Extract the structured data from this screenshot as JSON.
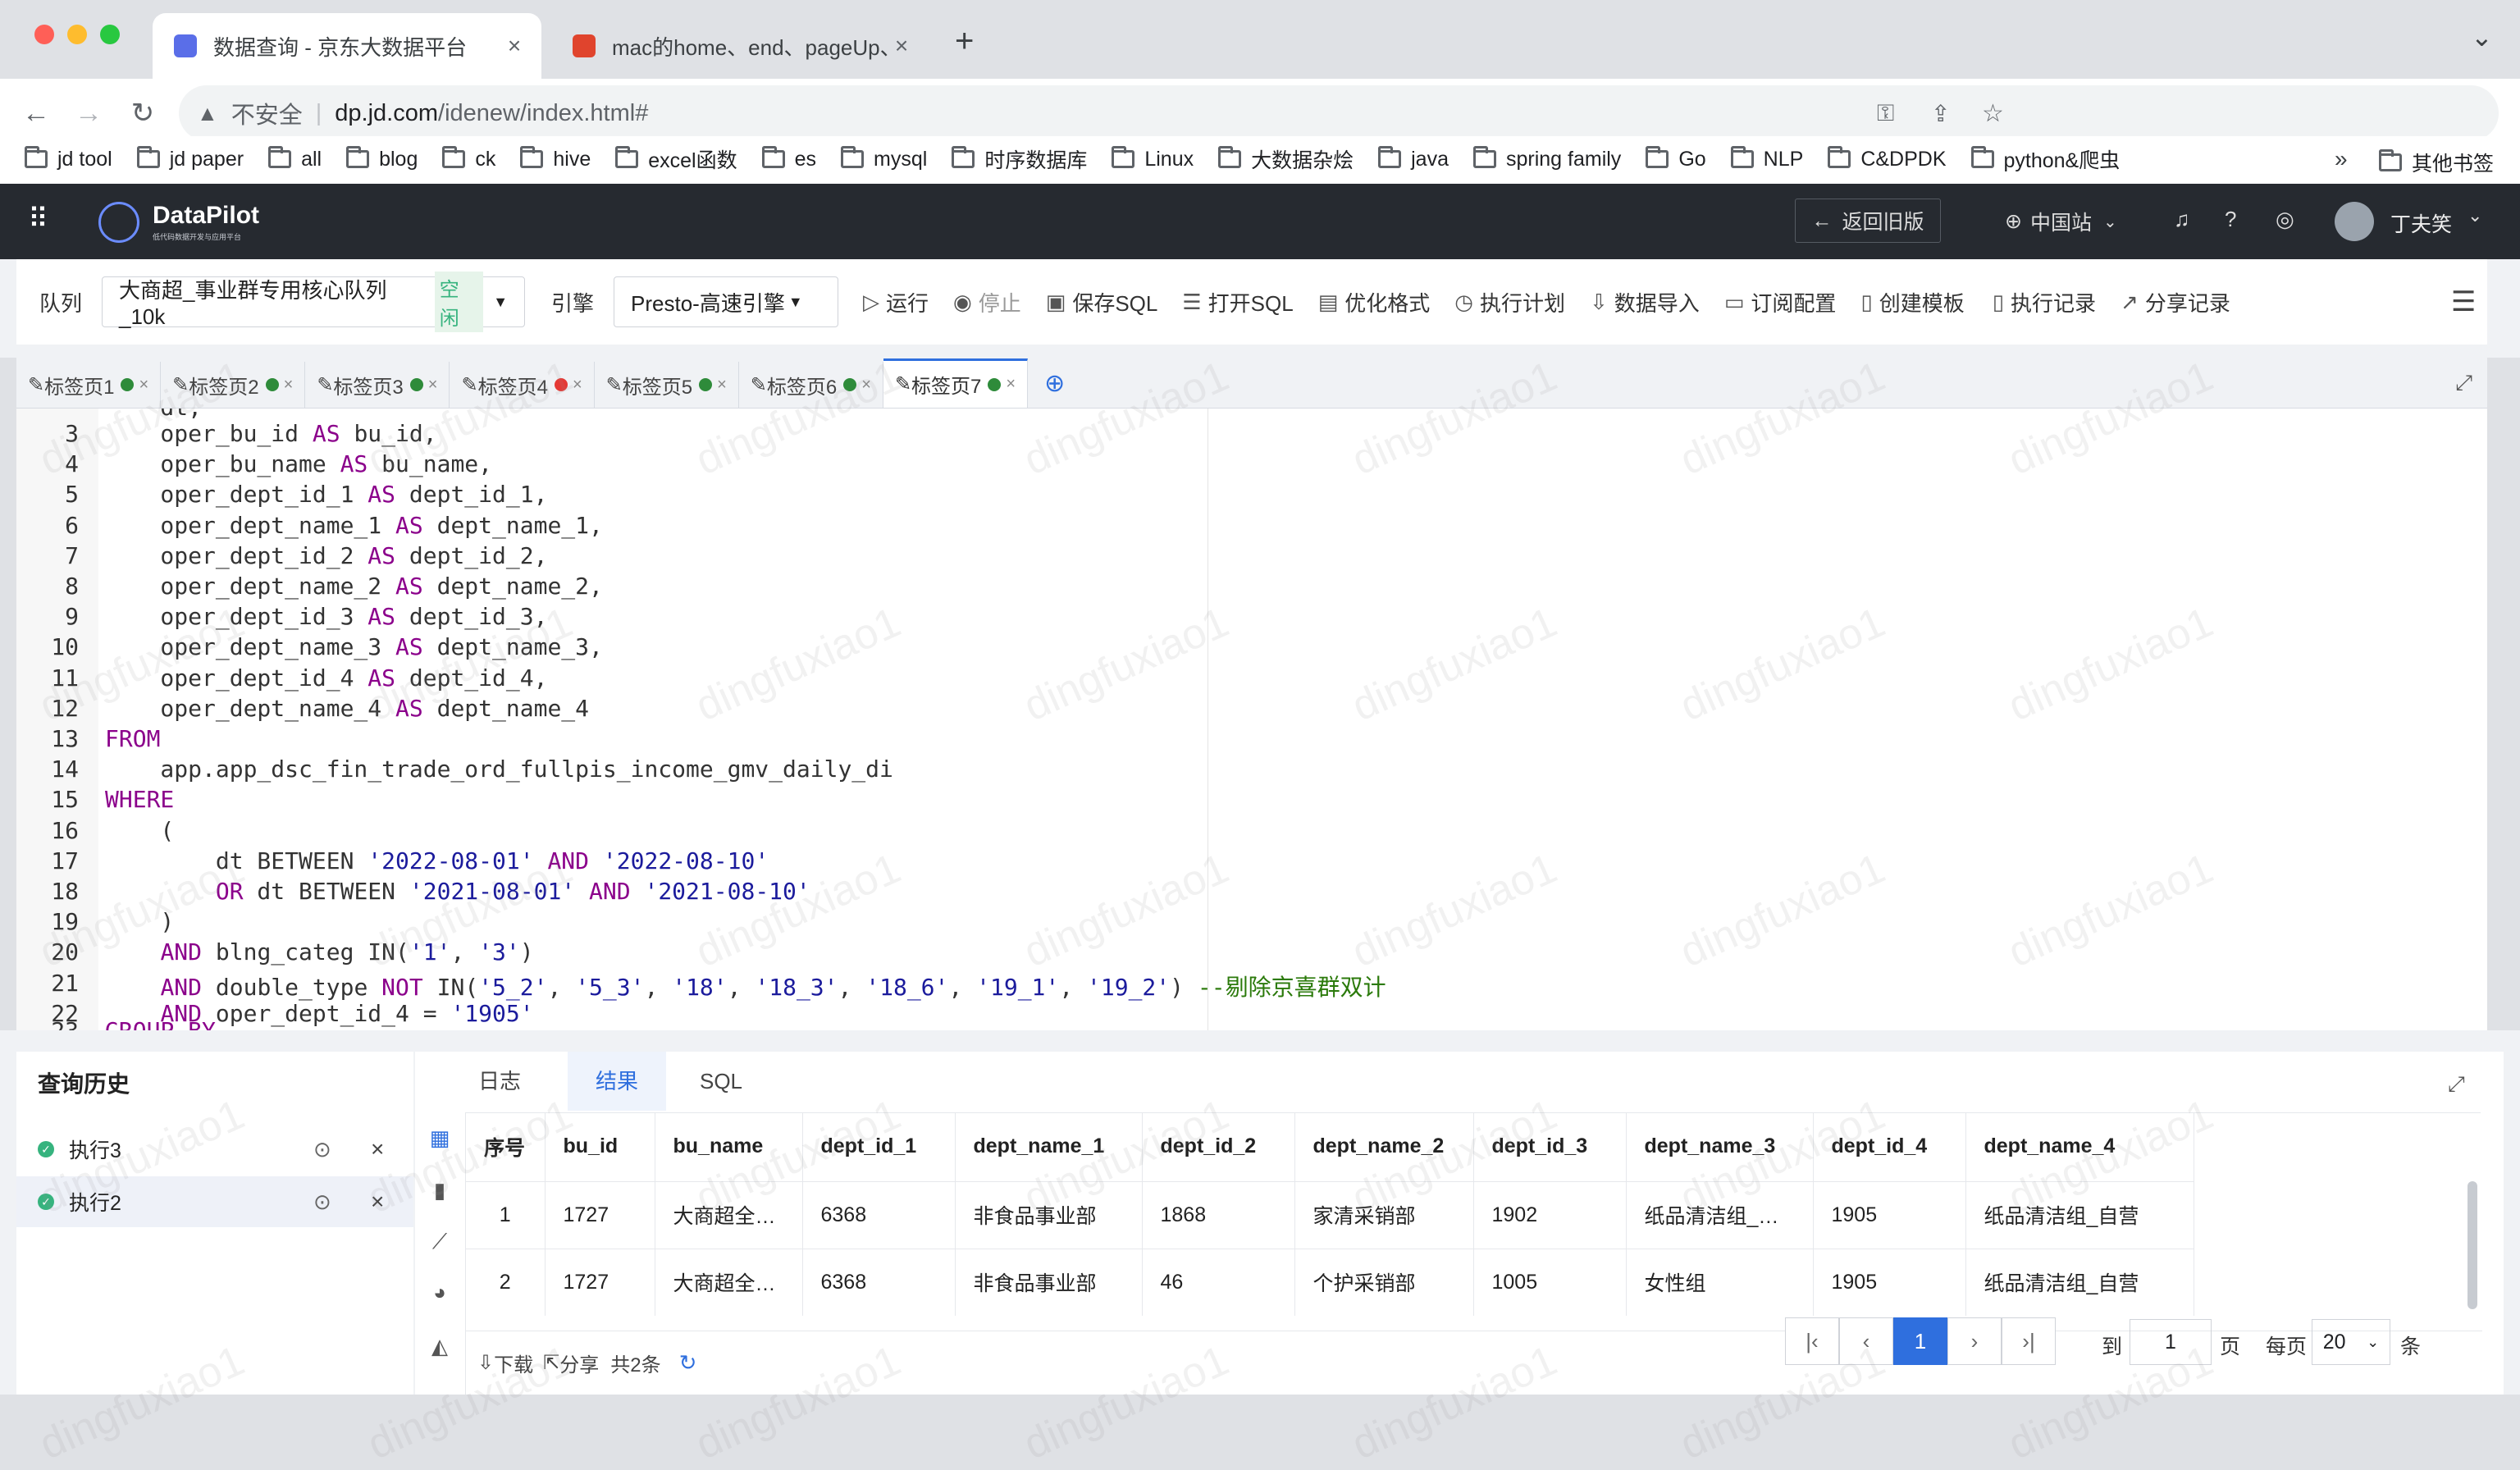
{
  "browser": {
    "tabs": [
      {
        "title": "数据查询 - 京东大数据平台",
        "close": "×",
        "favicon_color": "#5a6ee8"
      },
      {
        "title": "mac的home、end、pageUp、pageDown",
        "close": "×",
        "favicon_color": "#e0442d"
      }
    ],
    "new_tab": "+",
    "tab_menu": "⌄",
    "nav": {
      "back": "←",
      "forward": "→",
      "reload": "↻"
    },
    "security_label": "不安全",
    "url_domain": "dp.jd.com",
    "url_path": "/idenew/index.html#",
    "profile_initials": "夫笑",
    "bookmarks": [
      "jd tool",
      "jd paper",
      "all",
      "blog",
      "ck",
      "hive",
      "excel函数",
      "es",
      "mysql",
      "时序数据库",
      "Linux",
      "大数据杂烩",
      "java",
      "spring family",
      "Go",
      "NLP",
      "C&DPDK",
      "python&爬虫"
    ],
    "bookmarks_overflow": "»",
    "other_bookmarks": "其他书签"
  },
  "app": {
    "logo_title": "DataPilot",
    "logo_subtitle": "低代码数据开发与应用平台",
    "back_old": "返回旧版",
    "region": "中国站",
    "user_name": "丁夫笑"
  },
  "querybar": {
    "queue_label": "队列",
    "queue_value": "大商超_事业群专用核心队列_10k",
    "queue_status": "空闲",
    "engine_label": "引擎",
    "engine_value": "Presto-高速引擎",
    "actions": [
      {
        "icon": "▷",
        "label": "运行",
        "name": "run-button"
      },
      {
        "icon": "◉",
        "label": "停止",
        "name": "stop-button"
      },
      {
        "icon": "▣",
        "label": "保存SQL",
        "name": "save-sql-button"
      },
      {
        "icon": "☰",
        "label": "打开SQL",
        "name": "open-sql-button"
      },
      {
        "icon": "▤",
        "label": "优化格式",
        "name": "format-button"
      },
      {
        "icon": "◷",
        "label": "执行计划",
        "name": "exec-plan-button"
      },
      {
        "icon": "⇩",
        "label": "数据导入",
        "name": "data-import-button"
      },
      {
        "icon": "▭",
        "label": "订阅配置",
        "name": "subscribe-button"
      },
      {
        "icon": "▯",
        "label": "创建模板",
        "name": "create-template-button"
      },
      {
        "icon": "▯",
        "label": "执行记录",
        "name": "exec-record-button"
      },
      {
        "icon": "↗",
        "label": "分享记录",
        "name": "share-record-button"
      }
    ]
  },
  "editor_tabs": [
    {
      "label": "标签页1",
      "status": "#2e8b3a"
    },
    {
      "label": "标签页2",
      "status": "#2e8b3a"
    },
    {
      "label": "标签页3",
      "status": "#2e8b3a"
    },
    {
      "label": "标签页4",
      "status": "#e53935"
    },
    {
      "label": "标签页5",
      "status": "#2e8b3a"
    },
    {
      "label": "标签页6",
      "status": "#2e8b3a"
    },
    {
      "label": "标签页7",
      "status": "#2e8b3a"
    }
  ],
  "code_lines": [
    {
      "n": "3",
      "t": [
        [
          "    oper_bu_id ",
          ""
        ],
        [
          "AS",
          "kw"
        ],
        [
          " bu_id,",
          ""
        ]
      ]
    },
    {
      "n": "4",
      "t": [
        [
          "    oper_bu_name ",
          ""
        ],
        [
          "AS",
          "kw"
        ],
        [
          " bu_name,",
          ""
        ]
      ]
    },
    {
      "n": "5",
      "t": [
        [
          "    oper_dept_id_1 ",
          ""
        ],
        [
          "AS",
          "kw"
        ],
        [
          " dept_id_1,",
          ""
        ]
      ]
    },
    {
      "n": "6",
      "t": [
        [
          "    oper_dept_name_1 ",
          ""
        ],
        [
          "AS",
          "kw"
        ],
        [
          " dept_name_1,",
          ""
        ]
      ]
    },
    {
      "n": "7",
      "t": [
        [
          "    oper_dept_id_2 ",
          ""
        ],
        [
          "AS",
          "kw"
        ],
        [
          " dept_id_2,",
          ""
        ]
      ]
    },
    {
      "n": "8",
      "t": [
        [
          "    oper_dept_name_2 ",
          ""
        ],
        [
          "AS",
          "kw"
        ],
        [
          " dept_name_2,",
          ""
        ]
      ]
    },
    {
      "n": "9",
      "t": [
        [
          "    oper_dept_id_3 ",
          ""
        ],
        [
          "AS",
          "kw"
        ],
        [
          " dept_id_3,",
          ""
        ]
      ]
    },
    {
      "n": "10",
      "t": [
        [
          "    oper_dept_name_3 ",
          ""
        ],
        [
          "AS",
          "kw"
        ],
        [
          " dept_name_3,",
          ""
        ]
      ]
    },
    {
      "n": "11",
      "t": [
        [
          "    oper_dept_id_4 ",
          ""
        ],
        [
          "AS",
          "kw"
        ],
        [
          " dept_id_4,",
          ""
        ]
      ]
    },
    {
      "n": "12",
      "t": [
        [
          "    oper_dept_name_4 ",
          ""
        ],
        [
          "AS",
          "kw"
        ],
        [
          " dept_name_4",
          ""
        ]
      ]
    },
    {
      "n": "13",
      "t": [
        [
          "FROM",
          "kw"
        ]
      ]
    },
    {
      "n": "14",
      "t": [
        [
          "    app.app_dsc_fin_trade_ord_fullpis_income_gmv_daily_di",
          ""
        ]
      ]
    },
    {
      "n": "15",
      "t": [
        [
          "WHERE",
          "kw"
        ]
      ]
    },
    {
      "n": "16",
      "t": [
        [
          "    (",
          ""
        ]
      ]
    },
    {
      "n": "17",
      "t": [
        [
          "        dt BETWEEN ",
          ""
        ],
        [
          "'2022-08-01'",
          "str"
        ],
        [
          " ",
          ""
        ],
        [
          "AND",
          "kw"
        ],
        [
          " ",
          ""
        ],
        [
          "'2022-08-10'",
          "str"
        ]
      ]
    },
    {
      "n": "18",
      "t": [
        [
          "        ",
          ""
        ],
        [
          "OR",
          "kw"
        ],
        [
          " dt BETWEEN ",
          ""
        ],
        [
          "'2021-08-01'",
          "str"
        ],
        [
          " ",
          ""
        ],
        [
          "AND",
          "kw"
        ],
        [
          " ",
          ""
        ],
        [
          "'2021-08-10'",
          "str"
        ]
      ]
    },
    {
      "n": "19",
      "t": [
        [
          "    )",
          ""
        ]
      ]
    },
    {
      "n": "20",
      "t": [
        [
          "    ",
          ""
        ],
        [
          "AND",
          "kw"
        ],
        [
          " blng_categ IN(",
          ""
        ],
        [
          "'1'",
          "str"
        ],
        [
          ", ",
          ""
        ],
        [
          "'3'",
          "str"
        ],
        [
          ")",
          ""
        ]
      ]
    },
    {
      "n": "21",
      "t": [
        [
          "    ",
          ""
        ],
        [
          "AND",
          "kw"
        ],
        [
          " double_type ",
          ""
        ],
        [
          "NOT",
          "kw"
        ],
        [
          " IN(",
          ""
        ],
        [
          "'5_2'",
          "str"
        ],
        [
          ", ",
          ""
        ],
        [
          "'5_3'",
          "str"
        ],
        [
          ", ",
          ""
        ],
        [
          "'18'",
          "str"
        ],
        [
          ", ",
          ""
        ],
        [
          "'18_3'",
          "str"
        ],
        [
          ", ",
          ""
        ],
        [
          "'18_6'",
          "str"
        ],
        [
          ", ",
          ""
        ],
        [
          "'19_1'",
          "str"
        ],
        [
          ", ",
          ""
        ],
        [
          "'19_2'",
          "str"
        ],
        [
          ") ",
          ""
        ],
        [
          "--剔除京喜群双计",
          "cm"
        ]
      ]
    },
    {
      "n": "22",
      "t": [
        [
          "    ",
          ""
        ],
        [
          "AND",
          "kw"
        ],
        [
          " oper_dept_id_4 = ",
          ""
        ],
        [
          "'1905'",
          "str"
        ]
      ]
    }
  ],
  "history": {
    "title": "查询历史",
    "items": [
      {
        "label": "执行3",
        "selected": false
      },
      {
        "label": "执行2",
        "selected": true
      }
    ]
  },
  "results": {
    "tabs": [
      "日志",
      "结果",
      "SQL"
    ],
    "active_tab": "结果",
    "columns": [
      "序号",
      "bu_id",
      "bu_name",
      "dept_id_1",
      "dept_name_1",
      "dept_id_2",
      "dept_name_2",
      "dept_id_3",
      "dept_name_3",
      "dept_id_4",
      "dept_name_4"
    ],
    "rows": [
      [
        "1",
        "1727",
        "大商超全…",
        "6368",
        "非食品事业部",
        "1868",
        "家清采销部",
        "1902",
        "纸品清洁组_…",
        "1905",
        "纸品清洁组_自营"
      ],
      [
        "2",
        "1727",
        "大商超全…",
        "6368",
        "非食品事业部",
        "46",
        "个护采销部",
        "1005",
        "女性组",
        "1905",
        "纸品清洁组_自营"
      ]
    ],
    "download": "下载",
    "share": "分享",
    "total": "共2条",
    "pager": {
      "current": "1",
      "goto_label": "到",
      "goto_value": "1",
      "page_unit": "页",
      "per_page_label": "每页",
      "per_page": "20",
      "per_page_unit": "条"
    }
  },
  "watermark": "dingfuxiao1"
}
